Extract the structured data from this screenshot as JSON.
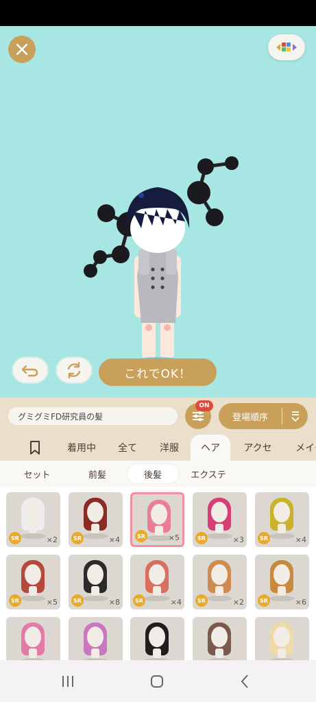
{
  "header": {
    "close_icon": "close-icon",
    "palette_icon": "palette-icon"
  },
  "controls": {
    "ok_label": "これでOK！",
    "undo_icon": "undo-icon",
    "refresh_icon": "refresh-icon"
  },
  "item_name": "グミグミFD研究員の髪",
  "filter": {
    "badge": "ON"
  },
  "sort": {
    "label": "登場順序"
  },
  "tabs": [
    {
      "label": ""
    },
    {
      "label": "着用中"
    },
    {
      "label": "全て"
    },
    {
      "label": "洋服"
    },
    {
      "label": "ヘア"
    },
    {
      "label": "アクセ"
    },
    {
      "label": "メイク"
    }
  ],
  "subtabs": [
    {
      "label": "セット"
    },
    {
      "label": "前髪"
    },
    {
      "label": "後髪"
    },
    {
      "label": "エクステ"
    }
  ],
  "items": [
    {
      "rarity": "SR",
      "count": "×2",
      "color": "#eeeeee"
    },
    {
      "rarity": "SR",
      "count": "×4",
      "color": "#8b2b24"
    },
    {
      "rarity": "SR",
      "count": "×5",
      "color": "#e97f95"
    },
    {
      "rarity": "SR",
      "count": "×3",
      "color": "#d63f74"
    },
    {
      "rarity": "SR",
      "count": "×4",
      "color": "#c9b32a"
    },
    {
      "rarity": "SR",
      "count": "×5",
      "color": "#b54a3c"
    },
    {
      "rarity": "SR",
      "count": "×8",
      "color": "#2b2b2b"
    },
    {
      "rarity": "SR",
      "count": "×4",
      "color": "#d87060"
    },
    {
      "rarity": "SR",
      "count": "×2",
      "color": "#cf8a4f"
    },
    {
      "rarity": "SR",
      "count": "×6",
      "color": "#c98a3e"
    },
    {
      "rarity": "",
      "count": "",
      "color": "#e37aa8"
    },
    {
      "rarity": "",
      "count": "",
      "color": "#c978c0"
    },
    {
      "rarity": "",
      "count": "",
      "color": "#1e1e1e"
    },
    {
      "rarity": "",
      "count": "",
      "color": "#7a5a4a"
    },
    {
      "rarity": "",
      "count": "",
      "color": "#efd9a6"
    }
  ],
  "colors": {
    "stage_bg": "#a7e6e3",
    "accent_gold": "#c9a05a",
    "selected_border": "#f28e9e",
    "badge_red": "#e0483e"
  }
}
